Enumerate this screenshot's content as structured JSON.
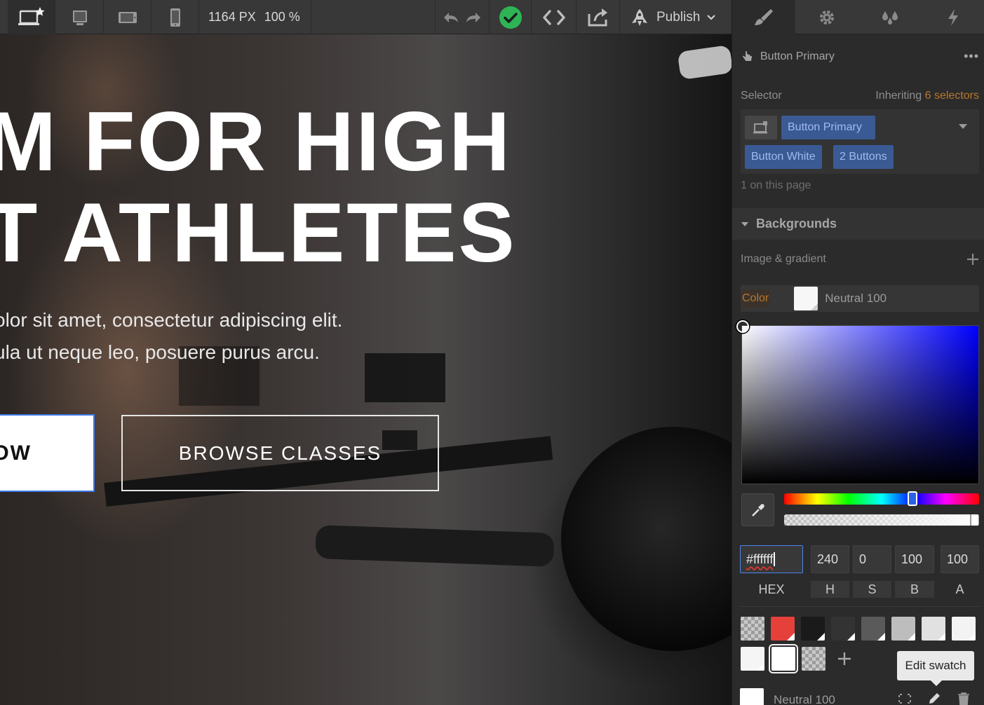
{
  "toolbar": {
    "width_value": "1164 PX",
    "zoom_value": "100 %",
    "publish_label": "Publish",
    "icons": [
      "desktop-star-icon",
      "desktop-icon",
      "tablet-landscape-icon",
      "mobile-icon",
      "undo-icon",
      "redo-icon",
      "check-circle-icon",
      "code-icon",
      "export-icon",
      "publish-rocket-icon",
      "chevron-down-icon"
    ],
    "status_color": "#2fb455"
  },
  "canvas": {
    "hero_line1": "M FOR HIGH",
    "hero_line2": "T ATHLETES",
    "sub_line1": "olor sit amet, consectetur adipiscing elit.",
    "sub_line2": "ula ut neque leo, posuere purus arcu.",
    "primary_button_label": "OW",
    "secondary_button_label": "BROWSE CLASSES",
    "selection_color": "#3b79e6"
  },
  "panel": {
    "tabs": [
      "style-brush-icon",
      "settings-gear-icon",
      "interactions-drops-icon",
      "lightning-icon"
    ],
    "element_name": "Button Primary",
    "more_label": "•••",
    "selector_label": "Selector",
    "inheriting_prefix": "Inheriting",
    "inheriting_count": "6 selectors",
    "chips": [
      "Button Primary",
      "Button White",
      "2 Buttons"
    ],
    "on_page": "1 on this page",
    "backgrounds_title": "Backgrounds",
    "image_gradient_label": "Image & gradient",
    "color_label": "Color",
    "color_value_name": "Neutral 100",
    "accent_orange": "#b7772e",
    "chip_bg": "#3a5a94"
  },
  "picker": {
    "hex_value": "#ffffff",
    "h_value": "240",
    "s_value": "0",
    "b_value": "100",
    "a_value": "100",
    "hex_label": "HEX",
    "h_label": "H",
    "s_label": "S",
    "b_label": "B",
    "a_label": "A",
    "hue_color": "#0000ff",
    "swatches_row1": [
      "checker",
      "#e5403a",
      "#1a1a1a",
      "#333333",
      "#5a5a5a",
      "#bdbdbd",
      "#e1e1e1",
      "#f3f3f3"
    ],
    "swatches_row2": [
      "#f5f5f5",
      "#ffffff",
      "checker"
    ],
    "add_swatch_label": "+",
    "tooltip": "Edit swatch",
    "bottom_swatch_name": "Neutral 100",
    "bottom_icons": [
      "unlink-icon",
      "pencil-icon",
      "trash-icon"
    ]
  }
}
